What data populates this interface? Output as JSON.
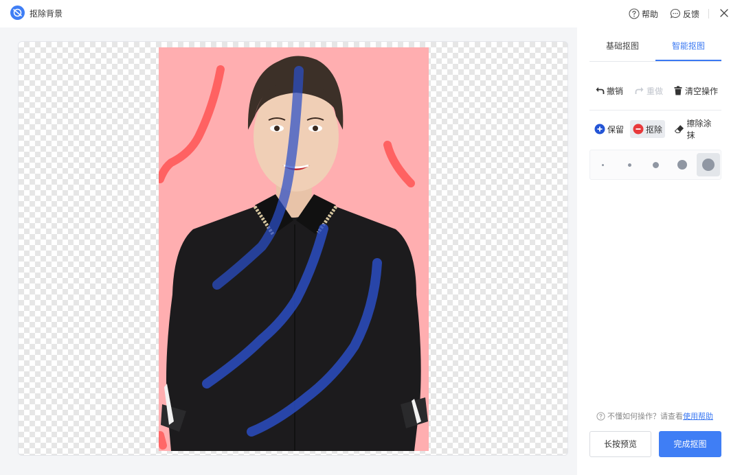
{
  "app": {
    "title": "抠除背景",
    "help_label": "帮助",
    "feedback_label": "反馈"
  },
  "tabs": [
    {
      "label": "基础抠图",
      "active": false
    },
    {
      "label": "智能抠图",
      "active": true
    }
  ],
  "tools": {
    "undo_label": "撤销",
    "redo_label": "重做",
    "redo_enabled": false,
    "clear_label": "清空操作"
  },
  "modes": {
    "keep_label": "保留",
    "remove_label": "抠除",
    "erase_label": "擦除涂抹",
    "selected": "remove"
  },
  "brush_sizes": {
    "options": [
      "extra-small",
      "small",
      "medium",
      "large",
      "extra-large"
    ],
    "selected": "extra-large"
  },
  "hint": {
    "text": "不懂如何操作？请查看",
    "link": "使用帮助"
  },
  "buttons": {
    "preview_label": "长按预览",
    "finish_label": "完成抠图"
  },
  "colors": {
    "accent": "#3f7ef5",
    "keep_stroke": "#2b4fc7",
    "remove_stroke": "#ff5a5a",
    "photo_background": "#ffaeb0",
    "remove_mode_bg": "#e9ebef"
  }
}
